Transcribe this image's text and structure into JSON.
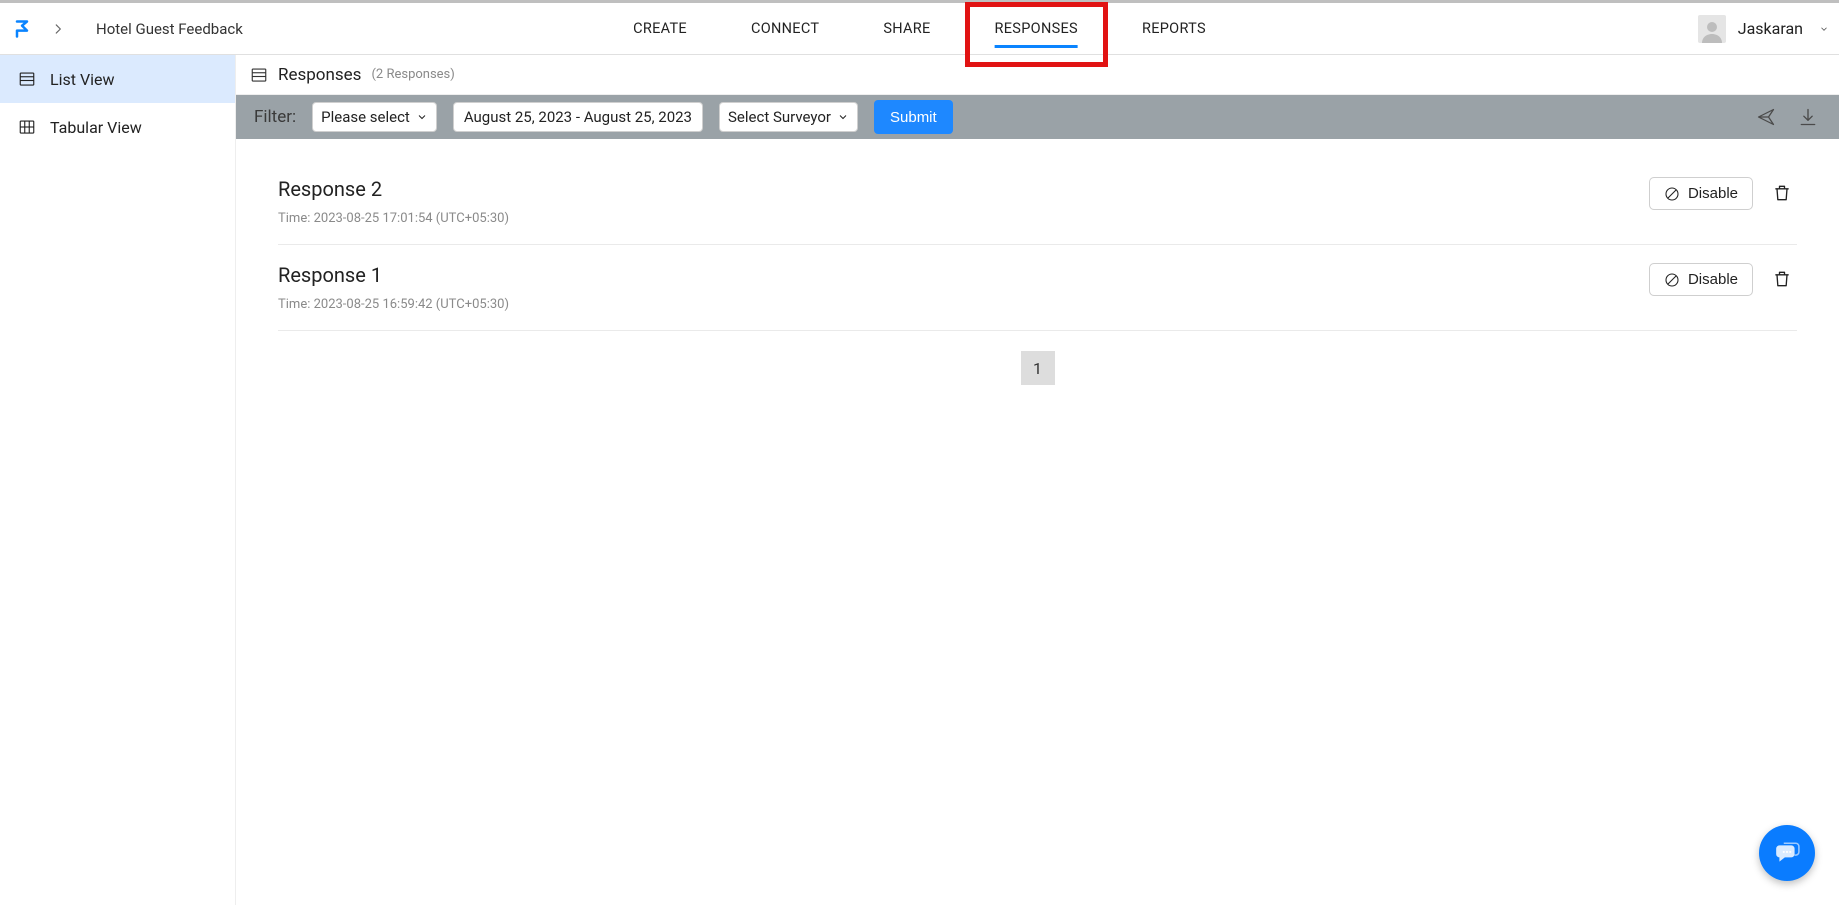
{
  "header": {
    "survey_title": "Hotel Guest Feedback",
    "nav": {
      "create": "CREATE",
      "connect": "CONNECT",
      "share": "SHARE",
      "responses": "RESPONSES",
      "reports": "REPORTS"
    },
    "username": "Jaskaran"
  },
  "sidebar": {
    "list_view": "List View",
    "tabular_view": "Tabular View"
  },
  "page": {
    "title": "Responses",
    "count_label": "(2 Responses)"
  },
  "filter": {
    "label": "Filter:",
    "please_select": "Please select",
    "date_range": "August 25, 2023 - August 25, 2023",
    "surveyor": "Select Surveyor",
    "submit": "Submit"
  },
  "responses": [
    {
      "title": "Response 2",
      "time": "Time: 2023-08-25 17:01:54 (UTC+05:30)",
      "disable": "Disable"
    },
    {
      "title": "Response 1",
      "time": "Time: 2023-08-25 16:59:42 (UTC+05:30)",
      "disable": "Disable"
    }
  ],
  "pagination": {
    "current": "1"
  }
}
